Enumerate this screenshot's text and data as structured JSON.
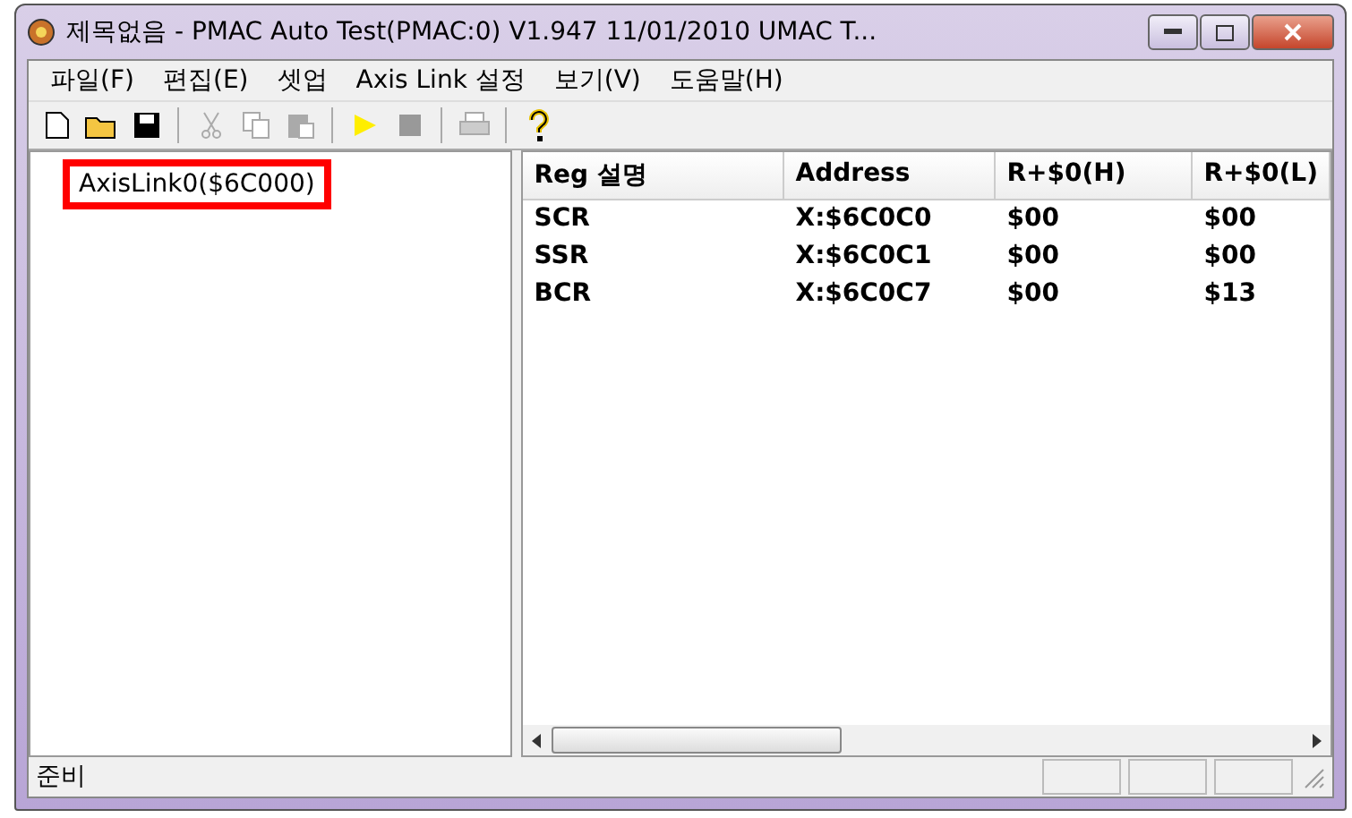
{
  "window": {
    "title": "제목없음 - PMAC Auto Test(PMAC:0) V1.947   11/01/2010 UMAC T..."
  },
  "menu": [
    "파일(F)",
    "편집(E)",
    "셋업",
    "Axis Link 설정",
    "보기(V)",
    "도움말(H)"
  ],
  "toolbar": [
    {
      "kind": "new",
      "disabled": false
    },
    {
      "kind": "open",
      "disabled": false
    },
    {
      "kind": "save",
      "disabled": false
    },
    {
      "kind": "sep"
    },
    {
      "kind": "cut",
      "disabled": true
    },
    {
      "kind": "copy",
      "disabled": true
    },
    {
      "kind": "paste",
      "disabled": true
    },
    {
      "kind": "sep"
    },
    {
      "kind": "play",
      "disabled": false
    },
    {
      "kind": "stop",
      "disabled": true
    },
    {
      "kind": "sep"
    },
    {
      "kind": "print",
      "disabled": true
    },
    {
      "kind": "sep"
    },
    {
      "kind": "help",
      "disabled": false
    }
  ],
  "tree": {
    "items": [
      {
        "label": "AxisLink0($6C000)",
        "highlighted": true
      }
    ]
  },
  "table": {
    "columns": [
      "Reg 설명",
      "Address",
      "R+$0(H)",
      "R+$0(L)"
    ],
    "rows": [
      [
        "SCR",
        "X:$6C0C0",
        "$00",
        "$00"
      ],
      [
        "SSR",
        "X:$6C0C1",
        "$00",
        "$00"
      ],
      [
        "BCR",
        "X:$6C0C7",
        "$00",
        "$13"
      ]
    ]
  },
  "status_bar": {
    "text": "준비"
  }
}
